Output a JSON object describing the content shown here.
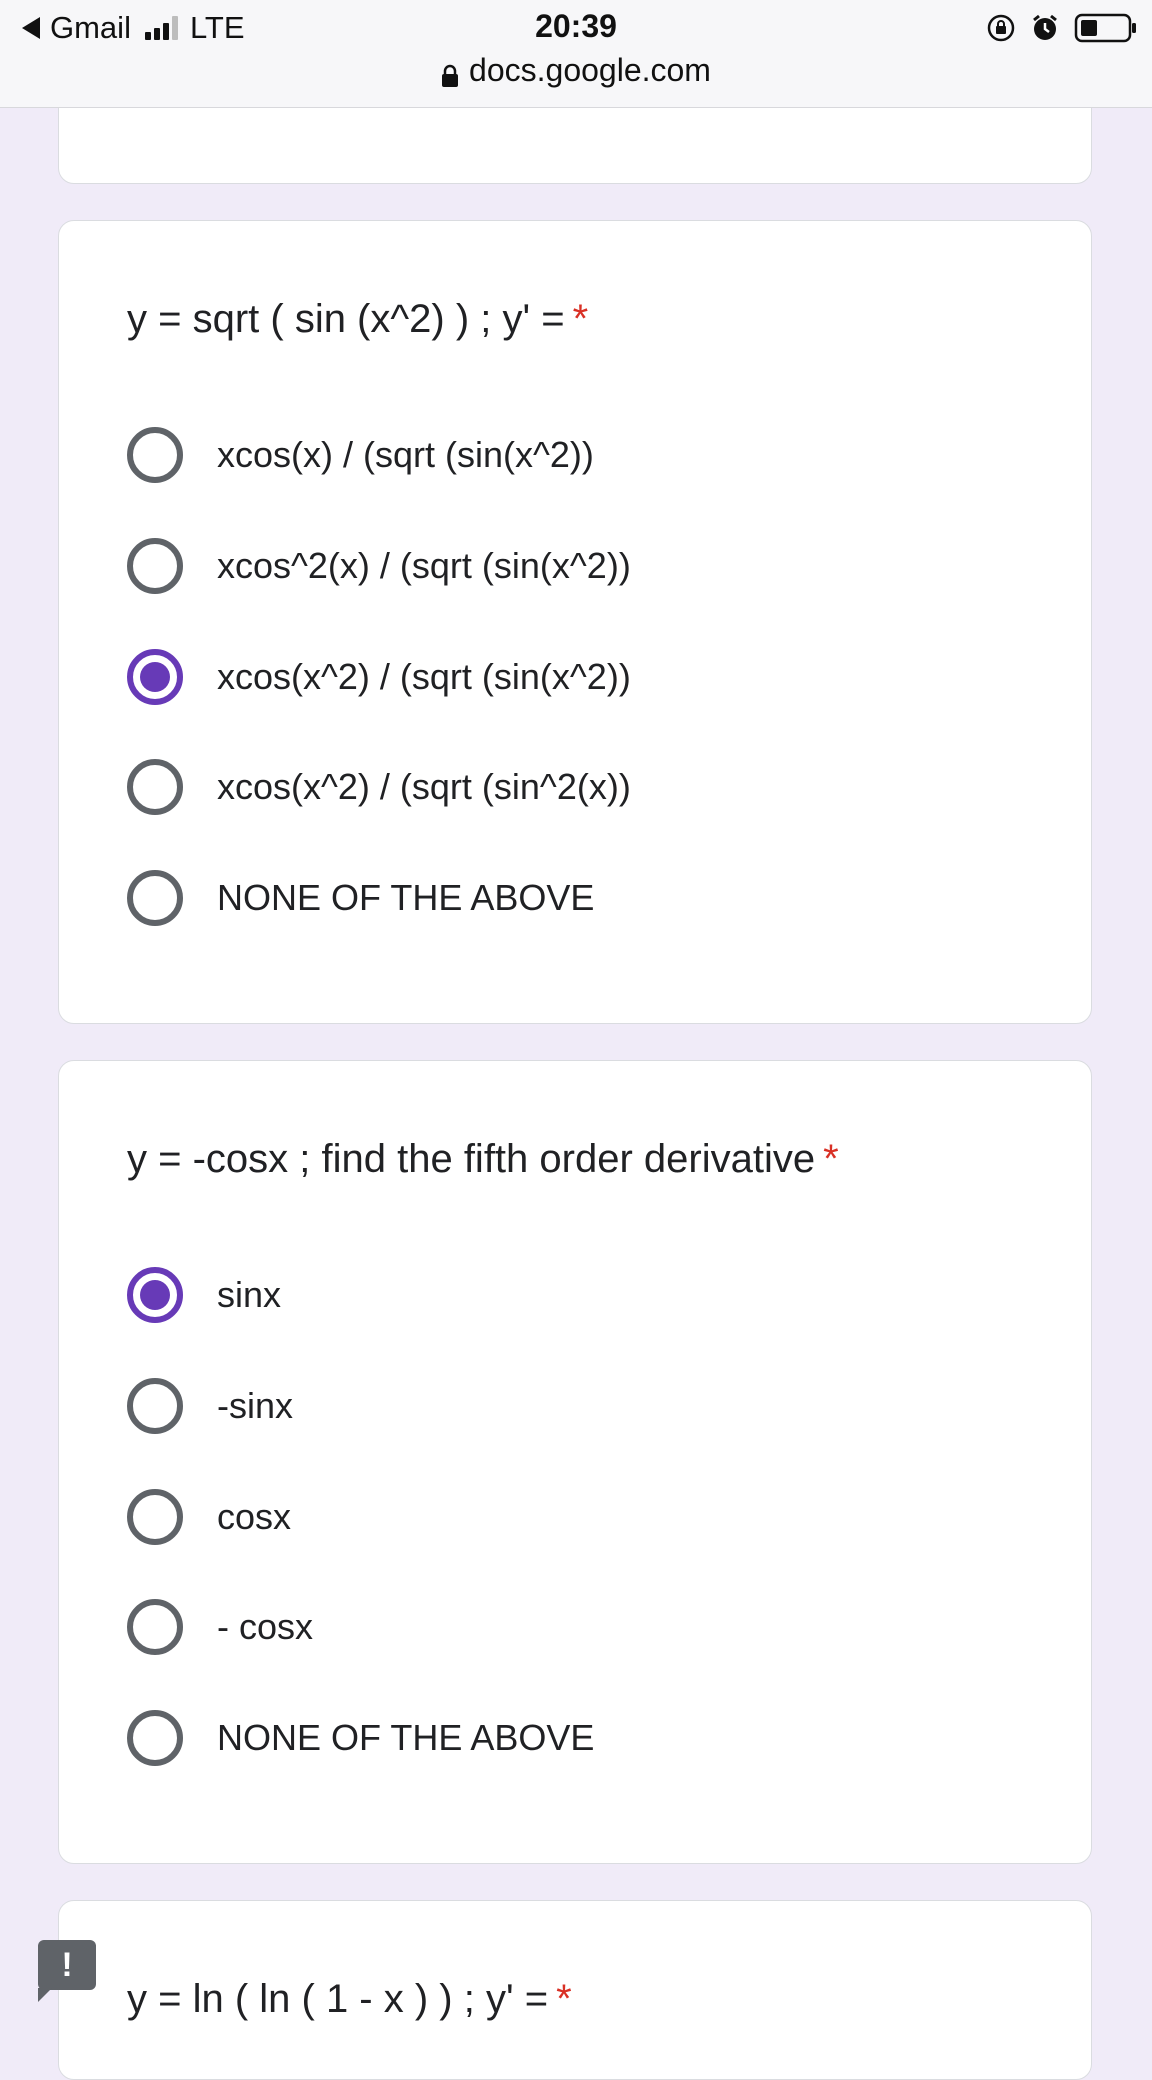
{
  "status_bar": {
    "back_app": "Gmail",
    "network": "LTE",
    "time": "20:39",
    "url": "docs.google.com"
  },
  "colors": {
    "accent": "#673ab7",
    "required": "#d93025",
    "background": "#f0ebf8"
  },
  "questions": [
    {
      "title": "y = sqrt ( sin (x^2) ) ; y' =",
      "required_mark": "*",
      "options": [
        {
          "label": "xcos(x) / (sqrt (sin(x^2))",
          "selected": false
        },
        {
          "label": "xcos^2(x) / (sqrt (sin(x^2))",
          "selected": false
        },
        {
          "label": "xcos(x^2) / (sqrt (sin(x^2))",
          "selected": true
        },
        {
          "label": "xcos(x^2) / (sqrt (sin^2(x))",
          "selected": false
        },
        {
          "label": "NONE OF THE ABOVE",
          "selected": false
        }
      ]
    },
    {
      "title": "y = -cosx ; find the fifth order derivative",
      "required_mark": "*",
      "options": [
        {
          "label": "sinx",
          "selected": true
        },
        {
          "label": "-sinx",
          "selected": false
        },
        {
          "label": "cosx",
          "selected": false
        },
        {
          "label": "- cosx",
          "selected": false
        },
        {
          "label": "NONE OF THE ABOVE",
          "selected": false
        }
      ]
    },
    {
      "title": "y = ln ( ln ( 1 - x ) ) ; y' =",
      "required_mark": "*"
    }
  ],
  "report_button": {
    "label": "!",
    "icon": "report-icon"
  }
}
